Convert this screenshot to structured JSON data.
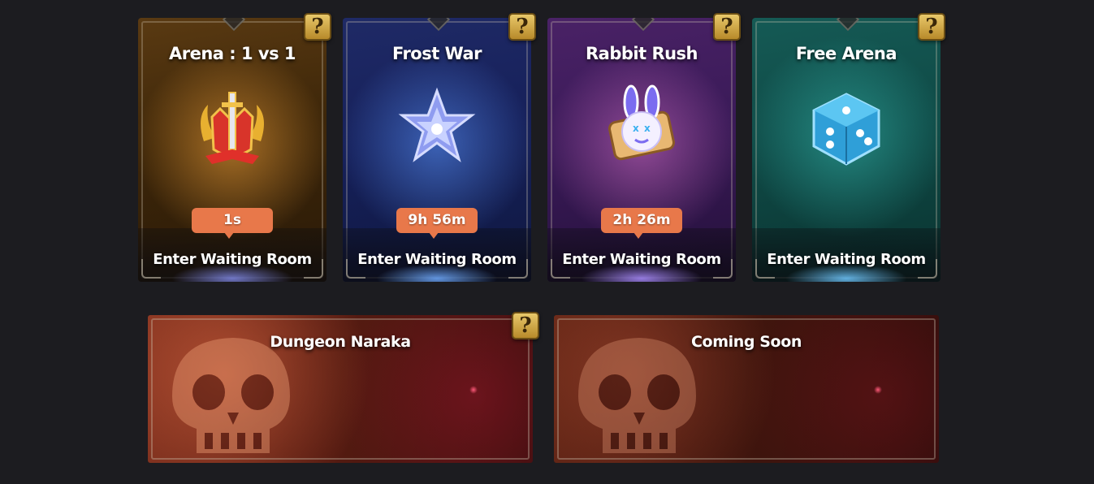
{
  "modes": [
    {
      "title": "Arena : 1 vs 1",
      "timer": "1s",
      "enter_label": "Enter Waiting Room",
      "help": "?"
    },
    {
      "title": "Frost War",
      "timer": "9h 56m",
      "enter_label": "Enter Waiting Room",
      "help": "?"
    },
    {
      "title": "Rabbit Rush",
      "timer": "2h 26m",
      "enter_label": "Enter Waiting Room",
      "help": "?"
    },
    {
      "title": "Free Arena",
      "enter_label": "Enter Waiting Room",
      "help": "?"
    }
  ],
  "dungeons": [
    {
      "title": "Dungeon Naraka",
      "help": "?"
    },
    {
      "title": "Coming Soon"
    }
  ],
  "colors": {
    "timer_badge": "#e8784a",
    "help_badge": "#d9b04a",
    "arena_card": "#3d2609",
    "frost_card": "#16205a",
    "rabbit_card": "#3a1a58",
    "free_card": "#0f4a46",
    "dungeon_panel": "#5a1d12"
  },
  "icons": {
    "arena": "crown-sword-trophy-icon",
    "frost": "ice-crystal-icon",
    "rabbit": "rabbit-scroll-icon",
    "free": "dice-icon",
    "help": "question-mark-icon",
    "dungeon_bg": "skull-icon"
  }
}
